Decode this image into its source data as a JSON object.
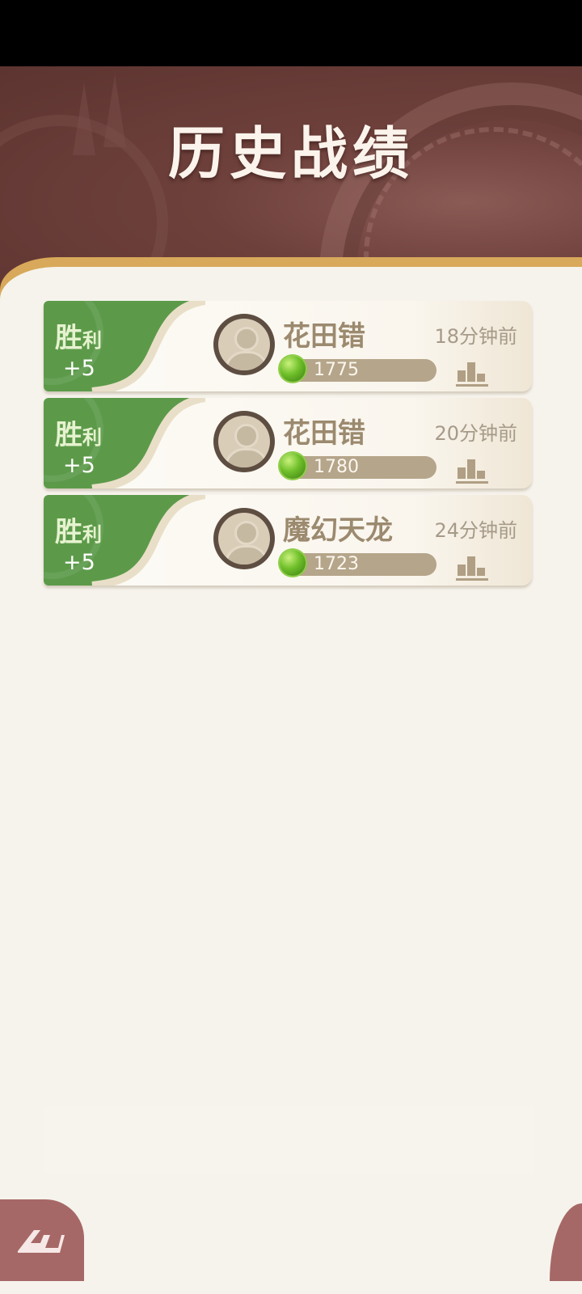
{
  "header": {
    "title": "历史战绩"
  },
  "records": [
    {
      "result_big": "胜",
      "result_small": "利",
      "score_change": "+5",
      "player": "花田错",
      "rating": "1775",
      "time_ago": "18分钟前"
    },
    {
      "result_big": "胜",
      "result_small": "利",
      "score_change": "+5",
      "player": "花田错",
      "rating": "1780",
      "time_ago": "20分钟前"
    },
    {
      "result_big": "胜",
      "result_small": "利",
      "score_change": "+5",
      "player": "魔幻天龙",
      "rating": "1723",
      "time_ago": "24分钟前"
    }
  ],
  "icons": {
    "avatar": "default-avatar-icon",
    "rating": "green-gem-icon",
    "stats": "bar-chart-icon",
    "back": "back-icon"
  },
  "colors": {
    "header_bg": "#6e403b",
    "win_green": "#5c9a4a",
    "panel_gold": "#d8a95a",
    "panel_bg": "#f6f3ec",
    "back_button": "#a66866"
  }
}
